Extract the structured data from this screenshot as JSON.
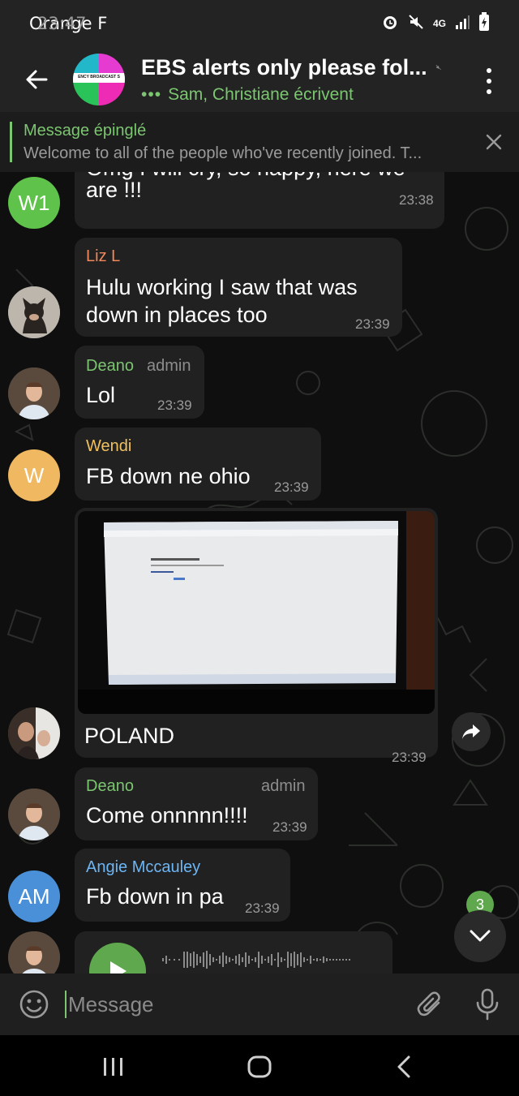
{
  "status_bar": {
    "carrier": "Orange F",
    "time": "23:47",
    "network": "4G"
  },
  "header": {
    "title": "EBS alerts only please fol...",
    "typing": "Sam, Christiane écrivent",
    "avatar_text": "ENCY BROADCAST S"
  },
  "pinned": {
    "title": "Message épinglé",
    "text": "Welcome to all of the people who've recently joined. T..."
  },
  "messages": [
    {
      "avatar": "W1",
      "lines": [
        "Omg I will cry, so happy, here we",
        "are !!!"
      ],
      "time": "23:38"
    },
    {
      "sender": "Liz L",
      "lines": [
        "Hulu working I saw that was",
        "down in places too"
      ],
      "time": "23:39"
    },
    {
      "sender": "Deano",
      "role": "admin",
      "lines": [
        "Lol"
      ],
      "time": "23:39"
    },
    {
      "sender": "Wendi",
      "avatar": "W",
      "lines": [
        "FB down ne ohio"
      ],
      "time": "23:39"
    },
    {
      "caption": "POLAND",
      "time": "23:39",
      "photo_text": [
        "Sorry, something went wrong.",
        "We're working on getting this fixed as soon as we can.",
        "Go Back"
      ]
    },
    {
      "sender": "Deano",
      "role": "admin",
      "lines": [
        "Come onnnnn!!!!"
      ],
      "time": "23:39"
    },
    {
      "sender": "Angie Mccauley",
      "avatar": "AM",
      "lines": [
        "Fb down in pa"
      ],
      "time": "23:39"
    }
  ],
  "unread_count": "3",
  "composer": {
    "placeholder": "Message"
  },
  "colors": {
    "accent_green": "#7cc571",
    "liz": "#f0885a",
    "deano": "#7cc571",
    "wendi": "#f0c060",
    "angie": "#6cb6f5",
    "avatar_w1": "#5fc24a",
    "avatar_w": "#f0b860",
    "avatar_am": "#4a90d9"
  },
  "icons": [
    "back-arrow-icon",
    "mute-icon",
    "more-vertical-icon",
    "close-icon",
    "share-icon",
    "chevron-down-icon",
    "emoji-icon",
    "attach-icon",
    "mic-icon",
    "play-icon"
  ]
}
